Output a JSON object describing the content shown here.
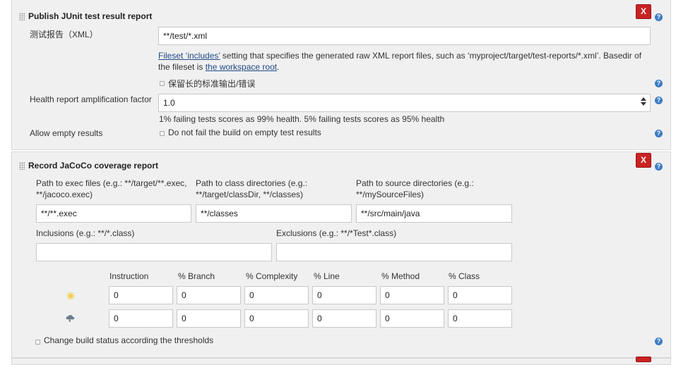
{
  "junit": {
    "title": "Publish JUnit test result report",
    "delete_label": "X",
    "help_glyph": "?",
    "test_report_label": "测试报告（XML）",
    "test_report_value": "**/test/*.xml",
    "desc_link1": "Fileset ‘includes’",
    "desc_text1": " setting that specifies the generated raw XML report files, such as ‘myproject/target/test-reports/*.xml’. Basedir of the fileset is ",
    "desc_link2": "the workspace root",
    "desc_text2": ".",
    "retain_output_label": "保留长的标准输出/错误",
    "health_label": "Health report amplification factor",
    "health_value": "1.0",
    "health_desc": "1% failing tests scores as 99% health. 5% failing tests scores as 95% health",
    "allow_empty_label": "Allow empty results",
    "allow_empty_checkbox": "Do not fail the build on empty test results"
  },
  "jacoco": {
    "title": "Record JaCoCo coverage report",
    "delete_label": "X",
    "help_glyph": "?",
    "exec_label": "Path to exec files (e.g.: **/target/**.exec, **/jacoco.exec)",
    "exec_value": "**/**.exec",
    "class_label": "Path to class directories (e.g.: **/target/classDir, **/classes)",
    "class_value": "**/classes",
    "source_label": "Path to source directories (e.g.: **/mySourceFiles)",
    "source_value": "**/src/main/java",
    "inclusions_label": "Inclusions (e.g.: **/*.class)",
    "inclusions_value": "",
    "exclusions_label": "Exclusions (e.g.: **/*Test*.class)",
    "exclusions_value": "",
    "threshold_headers": [
      "Instruction",
      "% Branch",
      "% Complexity",
      "% Line",
      "% Method",
      "% Class"
    ],
    "threshold_rows": [
      {
        "icon": "sunny-weather-icon",
        "values": [
          "0",
          "0",
          "0",
          "0",
          "0",
          "0"
        ]
      },
      {
        "icon": "stormy-weather-icon",
        "values": [
          "0",
          "0",
          "0",
          "0",
          "0",
          "0"
        ]
      }
    ],
    "change_status_label": "Change build status according the thresholds"
  },
  "colors": {
    "delete_button": "#c92222",
    "help_icon": "#3c7cc4",
    "link": "#204a87",
    "section_bg": "#f0f0f0"
  }
}
